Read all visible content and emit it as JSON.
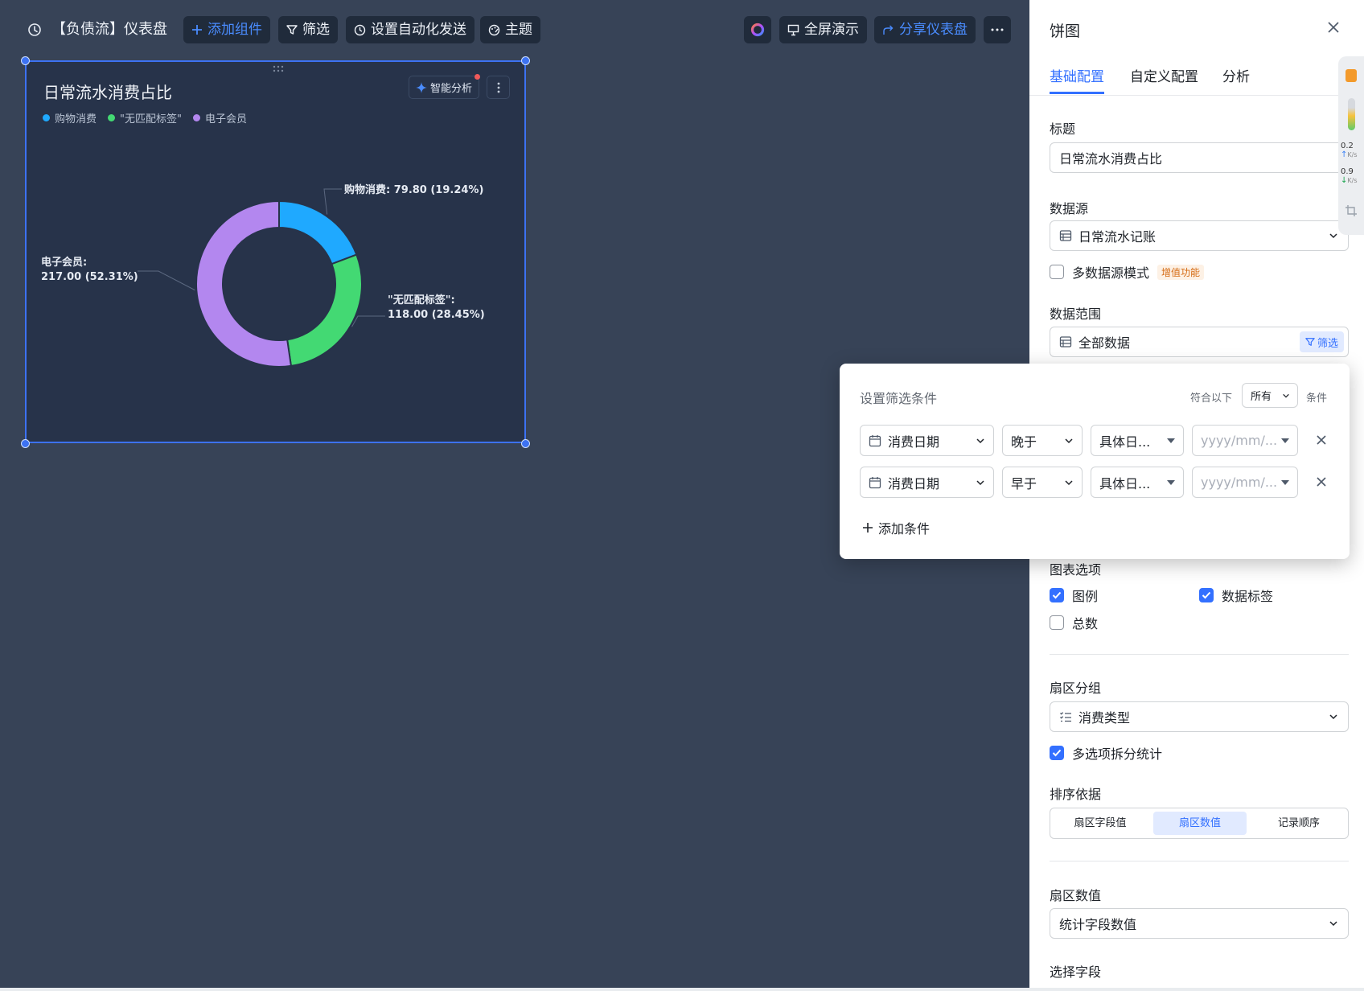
{
  "toolbar": {
    "dashboard_title": "【负债流】仪表盘",
    "add_component": "添加组件",
    "filter": "筛选",
    "automation": "设置自动化发送",
    "theme": "主题",
    "fullscreen": "全屏演示",
    "share": "分享仪表盘"
  },
  "card": {
    "title": "日常流水消费占比",
    "ai_analysis": "智能分析"
  },
  "chart_data": {
    "type": "pie",
    "title": "日常流水消费占比",
    "donut": true,
    "legend_position": "top-left",
    "categories": [
      "购物消费",
      "\"无匹配标签\"",
      "电子会员"
    ],
    "values": [
      79.8,
      118.0,
      217.0
    ],
    "percentages": [
      "19.24%",
      "28.45%",
      "52.31%"
    ],
    "colors": [
      "#1fa9ff",
      "#43d973",
      "#b387ef"
    ],
    "data_labels": [
      "购物消费: 79.80 (19.24%)",
      "\"无匹配标签\":",
      "118.00 (28.45%)",
      "电子会员:",
      "217.00 (52.31%)"
    ]
  },
  "panel": {
    "title": "饼图",
    "tabs": [
      "基础配置",
      "自定义配置",
      "分析"
    ],
    "title_label": "标题",
    "title_value": "日常流水消费占比",
    "datasource_label": "数据源",
    "datasource_value": "日常流水记账",
    "multi_source": "多数据源模式",
    "vip_badge": "增值功能",
    "range_label": "数据范围",
    "range_value": "全部数据",
    "range_filter": "筛选",
    "chart_options_label": "图表选项",
    "opt_legend": "图例",
    "opt_data_label": "数据标签",
    "opt_total": "总数",
    "group_label": "扇区分组",
    "group_value": "消费类型",
    "multi_split": "多选项拆分统计",
    "sort_label": "排序依据",
    "sort_options": [
      "扇区字段值",
      "扇区数值",
      "记录顺序"
    ],
    "value_label": "扇区数值",
    "value_value": "统计字段数值",
    "field_label": "选择字段"
  },
  "popup": {
    "title": "设置筛选条件",
    "match_prefix": "符合以下",
    "match_value": "所有",
    "match_suffix": "条件",
    "conditions": [
      {
        "field": "消费日期",
        "operator": "晚于",
        "mode": "具体日...",
        "value_placeholder": "yyyy/mm/..."
      },
      {
        "field": "消费日期",
        "operator": "早于",
        "mode": "具体日...",
        "value_placeholder": "yyyy/mm/..."
      }
    ],
    "add_condition": "添加条件"
  },
  "side_widget": {
    "rate_up": "0.2",
    "rate_down": "0.9",
    "unit": "K/s"
  }
}
